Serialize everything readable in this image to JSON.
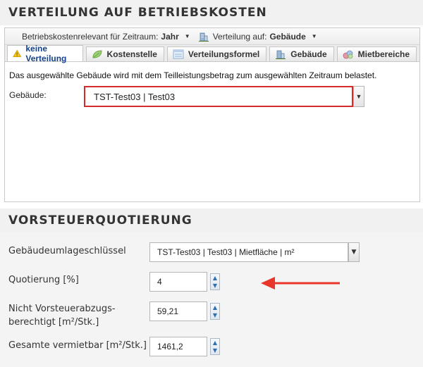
{
  "section1": {
    "title": "VERTEILUNG AUF BETRIEBSKOSTEN",
    "toolbar": {
      "period_label": "Betriebskostenrelevant für Zeitraum:",
      "period_value": "Jahr",
      "distribution_label": "Verteilung auf:",
      "distribution_value": "Gebäude"
    },
    "tabs": [
      {
        "label": "keine Verteilung",
        "icon": "warning-icon"
      },
      {
        "label": "Kostenstelle",
        "icon": "leaf-icon"
      },
      {
        "label": "Verteilungsformel",
        "icon": "formula-icon"
      },
      {
        "label": "Gebäude",
        "icon": "building-icon"
      },
      {
        "label": "Mietbereiche",
        "icon": "rooms-icon"
      }
    ],
    "info_text": "Das ausgewählte Gebäude wird mit dem Teilleistungsbetrag zum ausgewählten Zeitraum belastet.",
    "building_label": "Gebäude:",
    "building_value": "TST-Test03 | Test03"
  },
  "section2": {
    "title": "VORSTEUERQUOTIERUNG",
    "allocation_key_label": "Gebäudeumlageschlüssel",
    "allocation_key_value": "TST-Test03 | Test03 | Mietfläche | m²",
    "quota_label": "Quotierung [%]",
    "quota_value": "4",
    "non_deductible_label_line1": "Nicht Vorsteuerabzugs-",
    "non_deductible_label_line2": "berechtigt [m²/Stk.]",
    "non_deductible_value": "59,21",
    "total_rentable_label": "Gesamte vermietbar [m²/Stk.]",
    "total_rentable_value": "1461,2"
  },
  "colors": {
    "error_border": "#d62b2b",
    "arrow": "#e8372a",
    "active_tab_text": "#15428b",
    "section_bg": "#f1f1f1"
  }
}
